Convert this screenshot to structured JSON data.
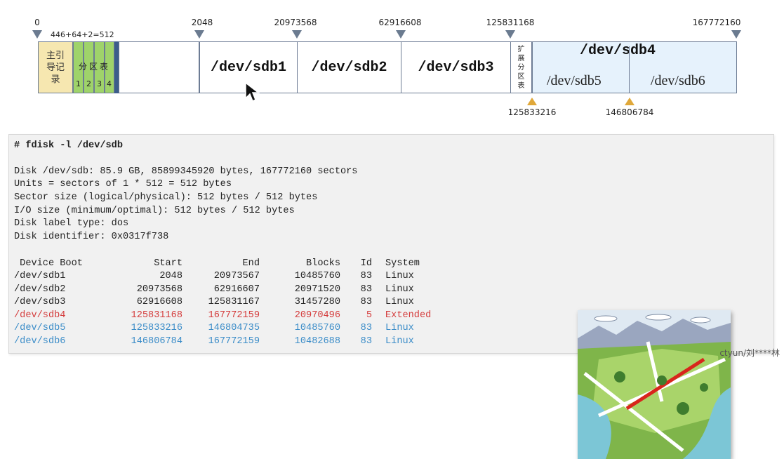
{
  "diagram": {
    "top_ticks": [
      "0",
      "2048",
      "20973568",
      "62916608",
      "125831168",
      "167772160"
    ],
    "mbr_size_label": "446+64+2=512",
    "mbr_label_line1": "主引",
    "mbr_label_line2": "导记",
    "mbr_label_line3": "录",
    "pt_label_1": "分",
    "pt_label_2": "区",
    "pt_label_3": "表",
    "pt_nums": [
      "1",
      "2",
      "3",
      "4"
    ],
    "partitions": [
      "/dev/sdb1",
      "/dev/sdb2",
      "/dev/sdb3"
    ],
    "ext_table_chars": [
      "扩",
      "展",
      "分",
      "区",
      "表"
    ],
    "extended_label": "/dev/sdb4",
    "logical": [
      "/dev/sdb5",
      "/dev/sdb6"
    ],
    "bottom_ticks": [
      "125833216",
      "146806784"
    ],
    "colors": {
      "mbr": "#f6e7b0",
      "partition_table": "#9fd36a",
      "extended": "#e6f2fc",
      "marker_down": "#6b7b90",
      "marker_up": "#e0a83a"
    }
  },
  "terminal": {
    "command": "# fdisk -l /dev/sdb",
    "info_lines": [
      "Disk /dev/sdb: 85.9 GB, 85899345920 bytes, 167772160 sectors",
      "Units = sectors of 1 * 512 = 512 bytes",
      "Sector size (logical/physical): 512 bytes / 512 bytes",
      "I/O size (minimum/optimal): 512 bytes / 512 bytes",
      "Disk label type: dos",
      "Disk identifier: 0x0317f738"
    ],
    "header": {
      "device": " Device Boot",
      "start": "Start",
      "end": "End",
      "blocks": "Blocks",
      "id": "Id",
      "system": "System"
    },
    "rows": [
      {
        "device": "/dev/sdb1",
        "start": "2048",
        "end": "20973567",
        "blocks": "10485760",
        "id": "83",
        "system": "Linux",
        "color": "#222222"
      },
      {
        "device": "/dev/sdb2",
        "start": "20973568",
        "end": "62916607",
        "blocks": "20971520",
        "id": "83",
        "system": "Linux",
        "color": "#222222"
      },
      {
        "device": "/dev/sdb3",
        "start": "62916608",
        "end": "125831167",
        "blocks": "31457280",
        "id": "83",
        "system": "Linux",
        "color": "#222222"
      },
      {
        "device": "/dev/sdb4",
        "start": "125831168",
        "end": "167772159",
        "blocks": "20970496",
        "id": "5",
        "system": "Extended",
        "color": "#d43b3b"
      },
      {
        "device": "/dev/sdb5",
        "start": "125833216",
        "end": "146804735",
        "blocks": "10485760",
        "id": "83",
        "system": "Linux",
        "color": "#3a8cc8"
      },
      {
        "device": "/dev/sdb6",
        "start": "146806784",
        "end": "167772159",
        "blocks": "10482688",
        "id": "83",
        "system": "Linux",
        "color": "#3a8cc8"
      }
    ]
  },
  "watermark": "ctyun/刘****林"
}
